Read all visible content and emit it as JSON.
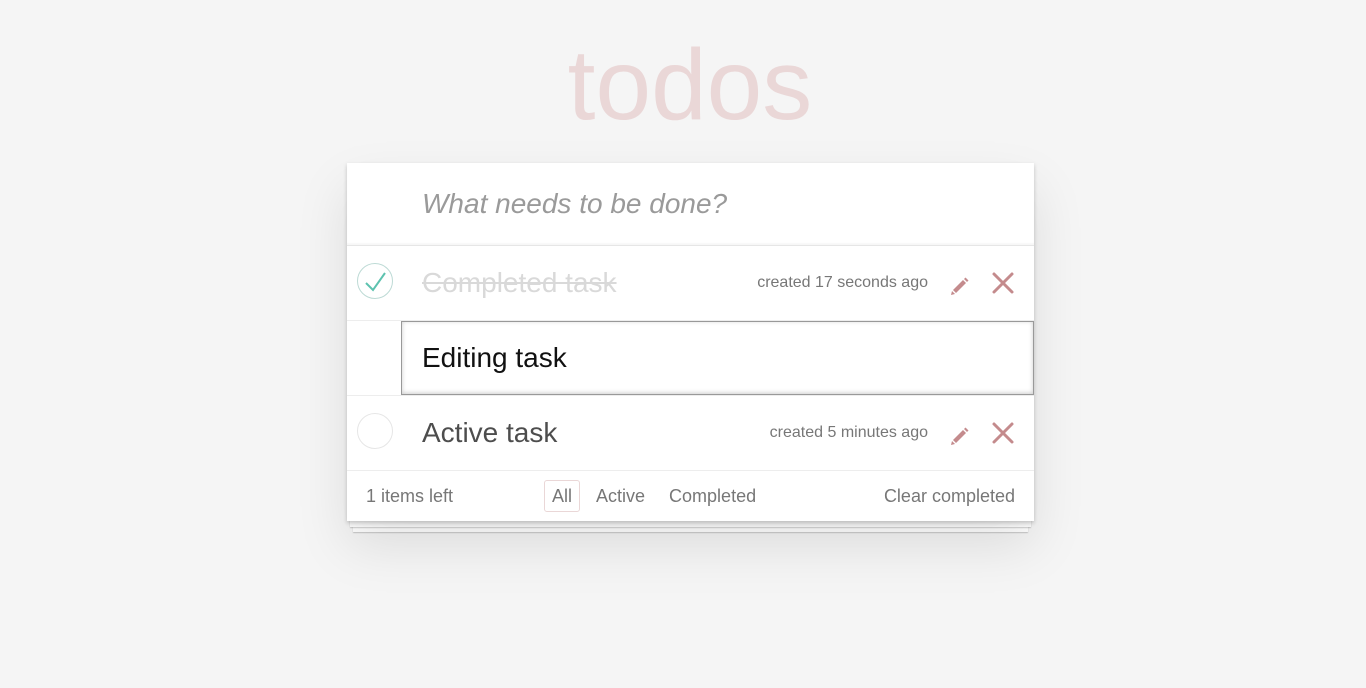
{
  "header": {
    "title": "todos"
  },
  "new_todo": {
    "placeholder": "What needs to be done?",
    "value": ""
  },
  "todos": [
    {
      "label": "Completed task",
      "created": "created 17 seconds ago",
      "completed": true,
      "editing": false
    },
    {
      "label": "Editing task",
      "created": "",
      "completed": false,
      "editing": true
    },
    {
      "label": "Active task",
      "created": "created 5 minutes ago",
      "completed": false,
      "editing": false
    }
  ],
  "footer": {
    "count_label": "1 items left",
    "filters": [
      {
        "label": "All",
        "selected": true
      },
      {
        "label": "Active",
        "selected": false
      },
      {
        "label": "Completed",
        "selected": false
      }
    ],
    "clear_label": "Clear completed"
  },
  "icons": {
    "check": "check-icon",
    "edit": "pencil-icon",
    "delete": "close-icon"
  },
  "colors": {
    "accent": "#af5b5e",
    "check": "#5dc2af",
    "title": "#ead7d7",
    "background": "#f5f5f5"
  }
}
